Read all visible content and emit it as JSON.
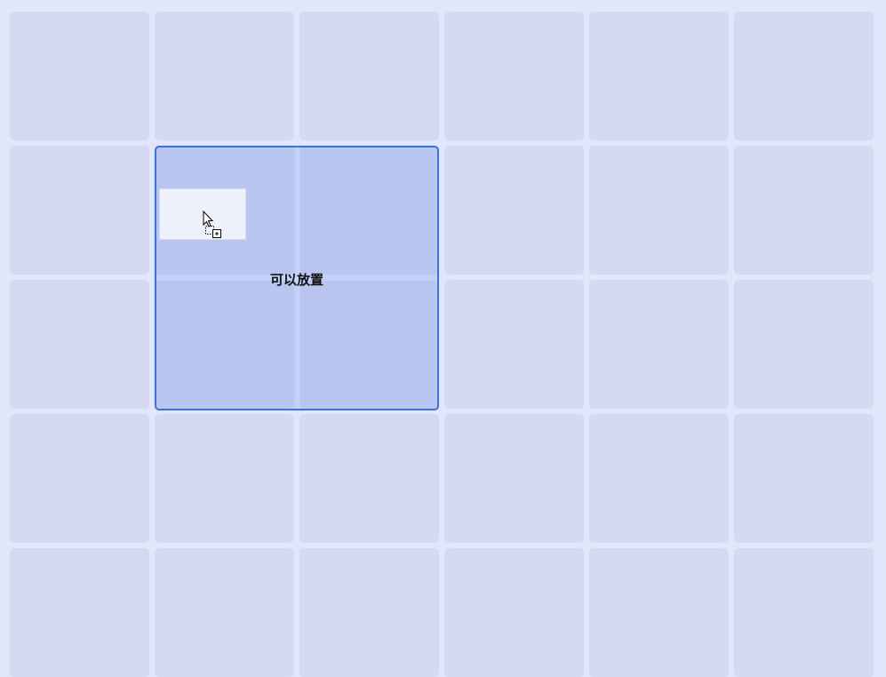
{
  "board": {
    "columns": 6,
    "rows": 5,
    "cells": [
      "",
      "",
      "",
      "",
      "",
      "",
      "",
      "",
      "",
      "",
      "",
      "",
      "",
      "",
      "",
      "",
      "",
      "",
      "",
      "",
      "",
      "",
      "",
      "",
      "",
      "",
      "",
      "",
      "",
      ""
    ]
  },
  "drop_zone": {
    "label": "可以放置",
    "span_columns": 2,
    "span_rows": 2,
    "accent_color": "#3b6fe6"
  },
  "drag_item": {
    "icon": "drag-copy-cursor-icon"
  }
}
